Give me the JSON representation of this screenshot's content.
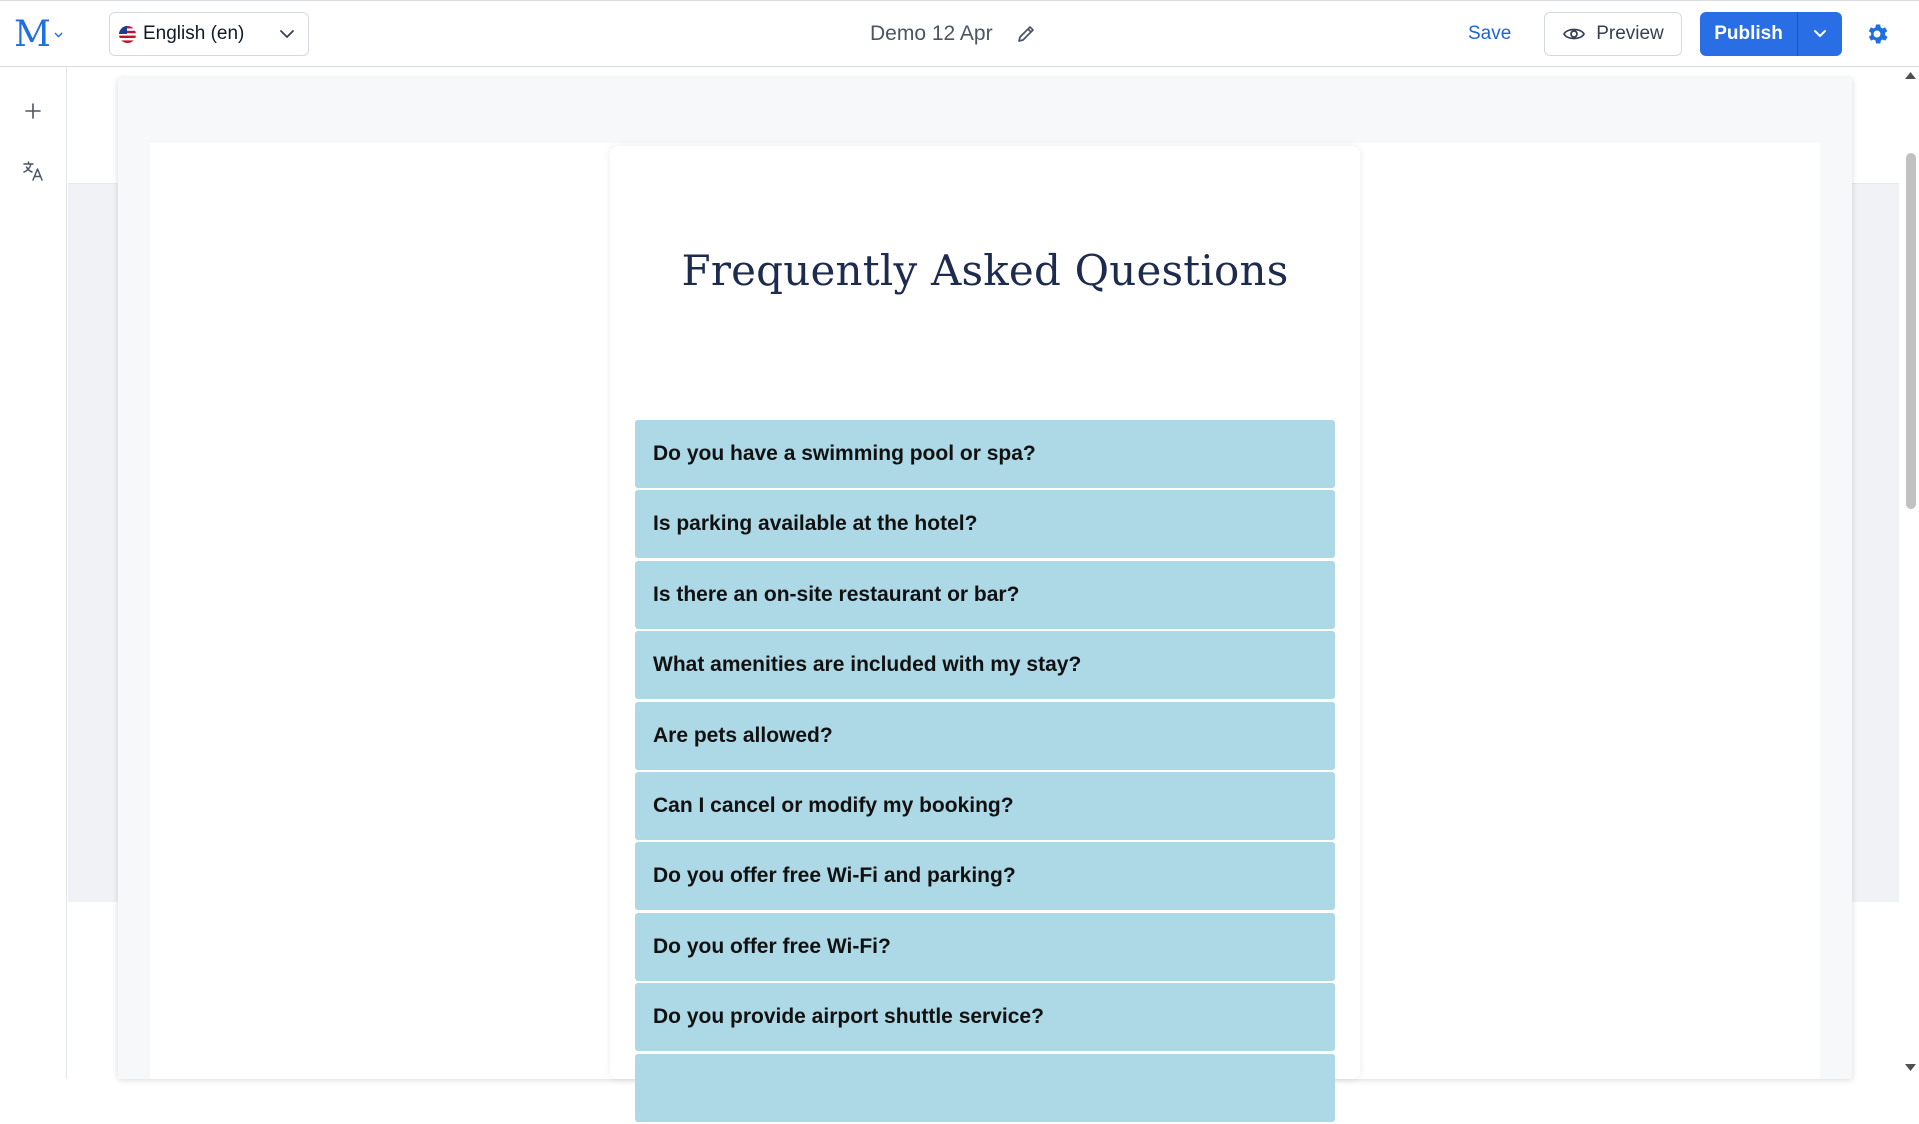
{
  "app": {
    "logo_letter": "M",
    "brand_color": "#1f6fe0"
  },
  "header": {
    "language": {
      "label": "English (en)",
      "flag": "us-flag-icon"
    },
    "document_title": "Demo 12 Apr",
    "save_label": "Save",
    "preview_label": "Preview",
    "publish_label": "Publish",
    "accent_color": "#2a6ee6"
  },
  "rail": {
    "items": [
      {
        "icon": "plus-icon"
      },
      {
        "icon": "translate-icon"
      }
    ]
  },
  "faq": {
    "title": "Frequently Asked Questions",
    "item_color": "#add8e6",
    "items": [
      {
        "question": "Do you have a swimming pool or spa?"
      },
      {
        "question": "Is parking available at the hotel?"
      },
      {
        "question": "Is there an on-site restaurant or bar?"
      },
      {
        "question": "What amenities are included with my stay?"
      },
      {
        "question": "Are pets allowed?"
      },
      {
        "question": "Can I cancel or modify my booking?"
      },
      {
        "question": "Do you offer free Wi-Fi and parking?"
      },
      {
        "question": "Do you offer free Wi-Fi?"
      },
      {
        "question": "Do you provide airport shuttle service?"
      },
      {
        "question": ""
      }
    ]
  }
}
